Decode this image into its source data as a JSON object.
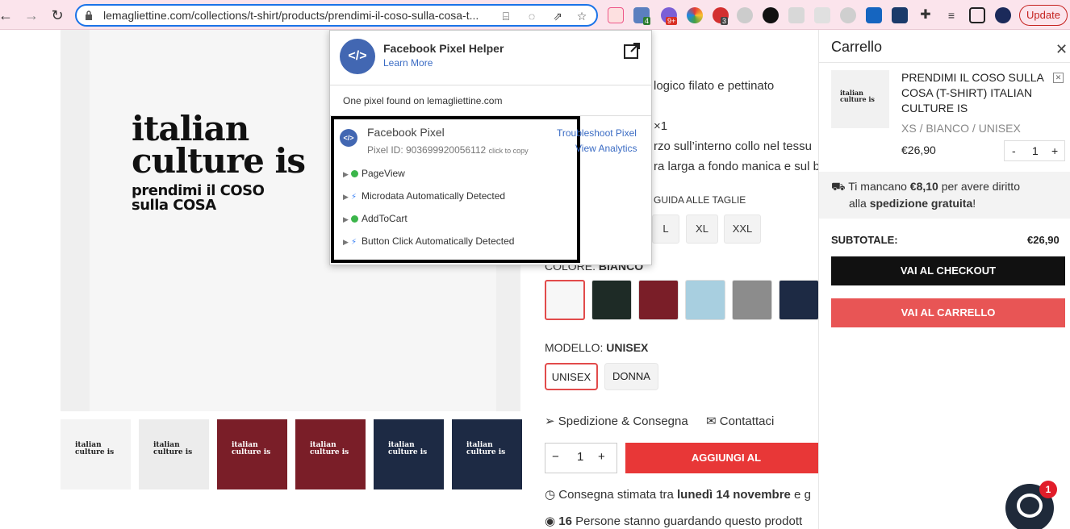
{
  "browser": {
    "url": "lemagliettine.com/collections/t-shirt/products/prendimi-il-coso-sulla-cosa-t...",
    "update_label": "Update",
    "ext_badges": {
      "tagassist": "4",
      "ext9": "9+",
      "ext3": "3"
    }
  },
  "product": {
    "shirt_line1": "italian",
    "shirt_line2": "culture is",
    "shirt_line3": "prendimi il COSO",
    "shirt_line4": "sulla COSA",
    "thumb_text": "italian culture is",
    "desc_line1": "logico filato e pettinato",
    "desc_line2": "×1",
    "desc_line3": "rzo sull’interno collo nel tessu",
    "desc_line4": "ra larga a fondo manica e sul b",
    "size_guide": "GUIDA ALLE TAGLIE",
    "sizes": [
      "L",
      "XL",
      "XXL"
    ],
    "color_label": "COLORE:",
    "color_value": "BIANCO",
    "swatch_colors": [
      "#f7f7f7",
      "#1e2b26",
      "#7a1e28",
      "#a8cfe0",
      "#8c8c8c",
      "#1d2a44"
    ],
    "model_label": "MODELLO:",
    "model_value": "UNISEX",
    "models": [
      "UNISEX",
      "DONNA"
    ],
    "shipping_link": "Spedizione & Consegna",
    "contacts_link": "Contattaci",
    "qty": "1",
    "qty_minus": "−",
    "qty_plus": "+",
    "add_to_cart": "AGGIUNGI AL",
    "delivery_prefix": "Consegna stimata tra ",
    "delivery_date": "lunedì 14 novembre",
    "delivery_suffix": " e g",
    "viewers_count": "16",
    "viewers_text": " Persone stanno guardando questo prodott"
  },
  "pixel_popup": {
    "title": "Facebook Pixel Helper",
    "learn_more": "Learn More",
    "found": "One pixel found on lemagliettine.com",
    "pixel_name": "Facebook Pixel",
    "pixel_id_label": "Pixel ID: 903699920056112",
    "click_to_copy": "click to copy",
    "troubleshoot": "Troubleshoot Pixel",
    "view_analytics": "View Analytics",
    "events": [
      {
        "name": "PageView",
        "kind": "check"
      },
      {
        "name": "Microdata Automatically Detected",
        "kind": "bolt"
      },
      {
        "name": "AddToCart",
        "kind": "check"
      },
      {
        "name": "Button Click Automatically Detected",
        "kind": "bolt"
      }
    ]
  },
  "cart": {
    "title": "Carrello",
    "item_name": "PRENDIMI IL COSO SULLA COSA (T-SHIRT) ITALIAN CULTURE IS",
    "item_variant": "XS / BIANCO / UNISEX",
    "item_price": "€26,90",
    "item_qty": "1",
    "ship_prefix": "Ti mancano ",
    "ship_amount": "€8,10",
    "ship_middle": " per avere diritto",
    "ship_line2_prefix": "alla ",
    "ship_bold": "spedizione gratuita",
    "ship_end": "!",
    "subtotal_label": "SUBTOTALE:",
    "subtotal_value": "€26,90",
    "checkout": "VAI AL CHECKOUT",
    "go_cart": "VAI AL CARRELLO"
  },
  "chat": {
    "badge": "1"
  }
}
